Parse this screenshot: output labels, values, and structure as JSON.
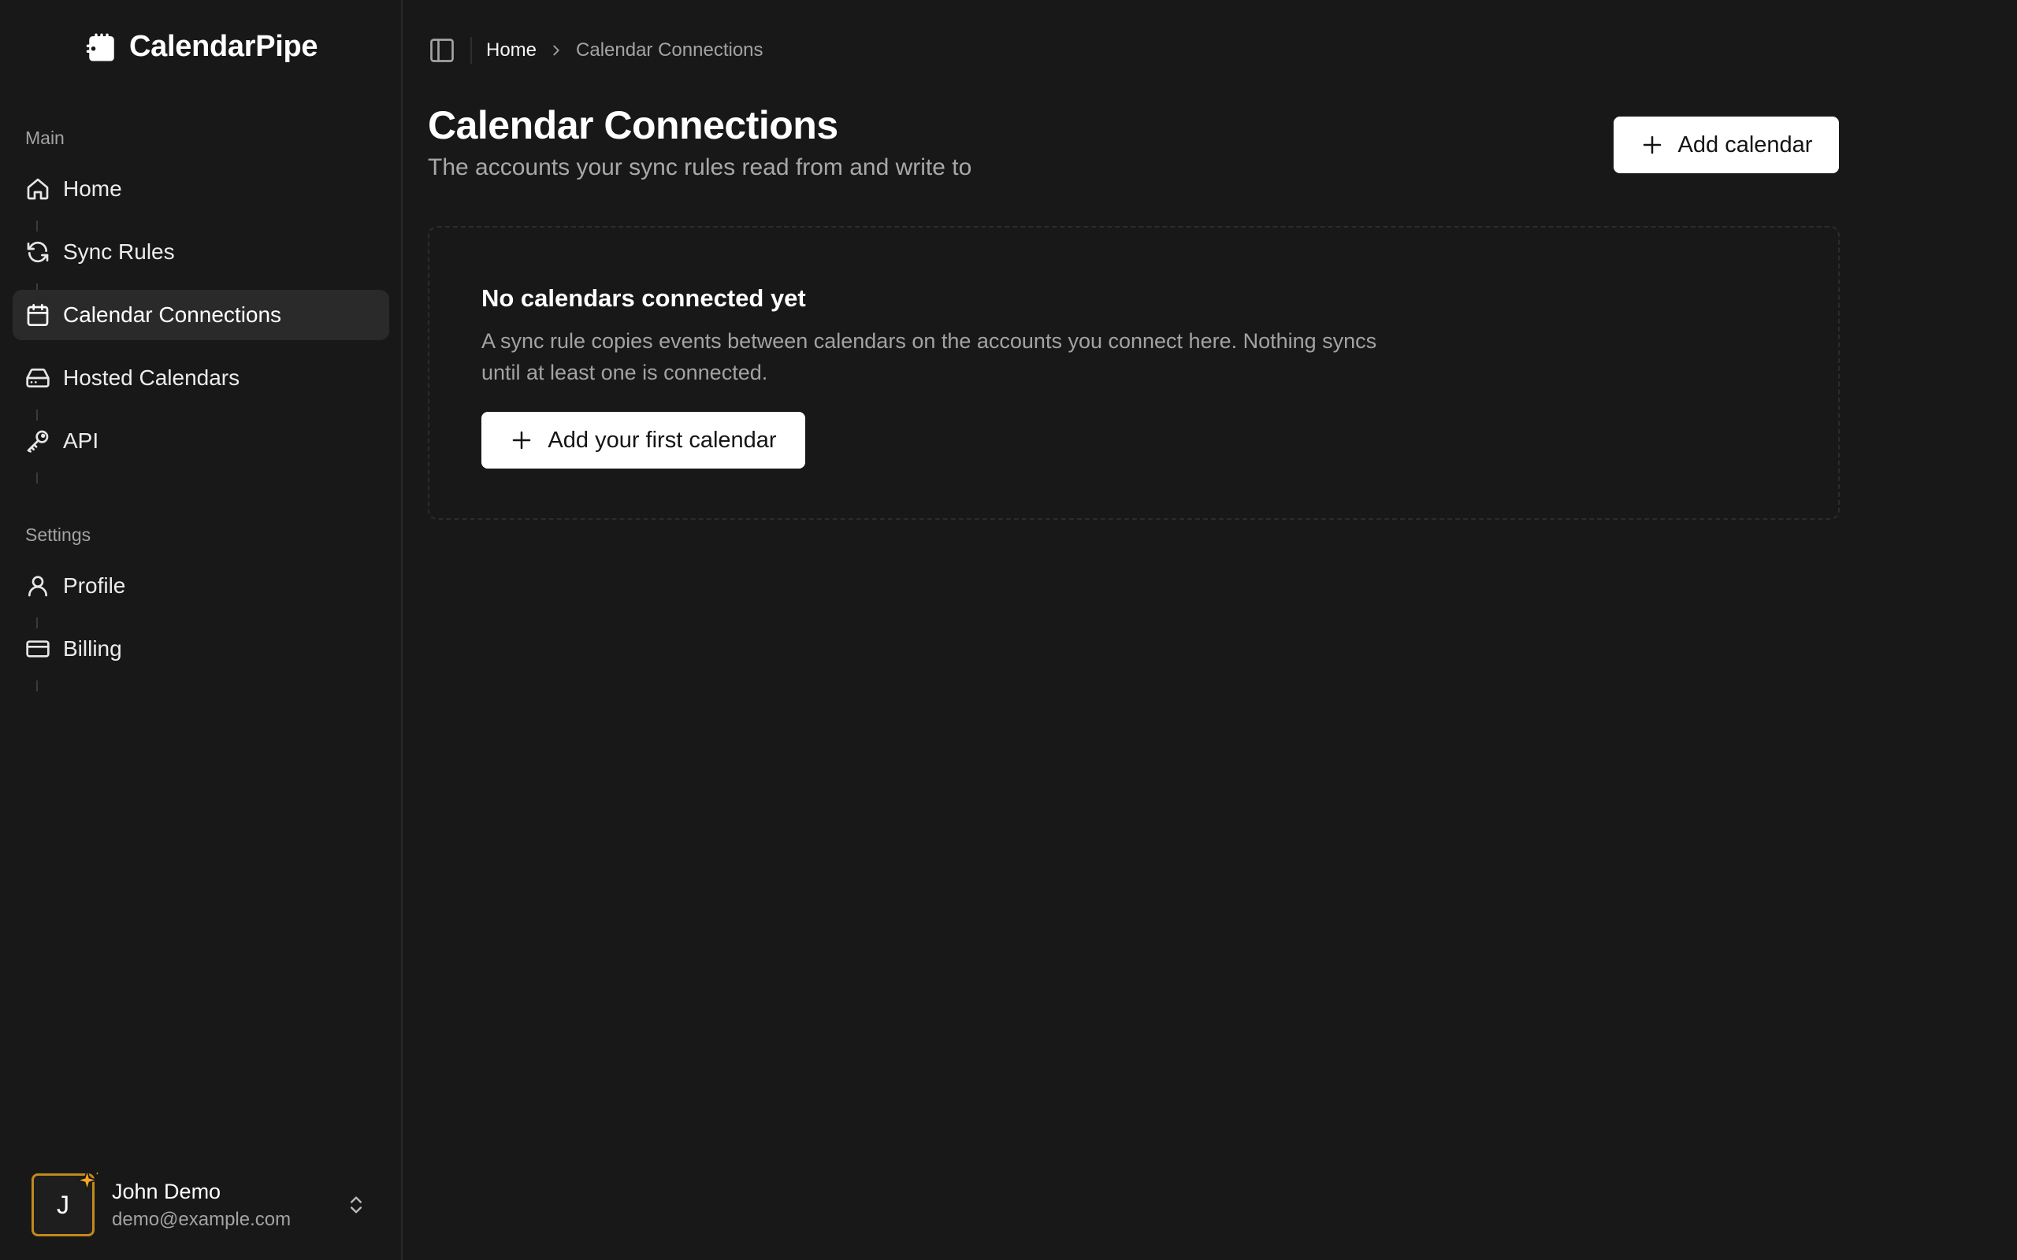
{
  "brand": {
    "name": "CalendarPipe"
  },
  "sidebar": {
    "main_label": "Main",
    "main_items": [
      {
        "label": "Home",
        "icon": "home-icon"
      },
      {
        "label": "Sync Rules",
        "icon": "refresh-icon"
      },
      {
        "label": "Calendar Connections",
        "icon": "calendar-icon",
        "active": true
      },
      {
        "label": "Hosted Calendars",
        "icon": "hard-drive-icon"
      },
      {
        "label": "API",
        "icon": "key-icon"
      }
    ],
    "settings_label": "Settings",
    "settings_items": [
      {
        "label": "Profile",
        "icon": "user-icon"
      },
      {
        "label": "Billing",
        "icon": "credit-card-icon"
      }
    ],
    "user": {
      "initial": "J",
      "name": "John Demo",
      "email": "demo@example.com"
    }
  },
  "header": {
    "breadcrumb": {
      "home": "Home",
      "current": "Calendar Connections"
    }
  },
  "main": {
    "title": "Calendar Connections",
    "subtitle": "The accounts your sync rules read from and write to",
    "add_button": "Add calendar",
    "empty_state": {
      "title": "No calendars connected yet",
      "description": "A sync rule copies events between calendars on the accounts you connect here. Nothing syncs until at least one is connected.",
      "button": "Add your first calendar"
    }
  },
  "colors": {
    "background": "#181818",
    "active_item": "#2a2a2a",
    "avatar_border": "#c28a1b",
    "sparkle": "#f5a623",
    "button_bg": "#ffffff"
  }
}
